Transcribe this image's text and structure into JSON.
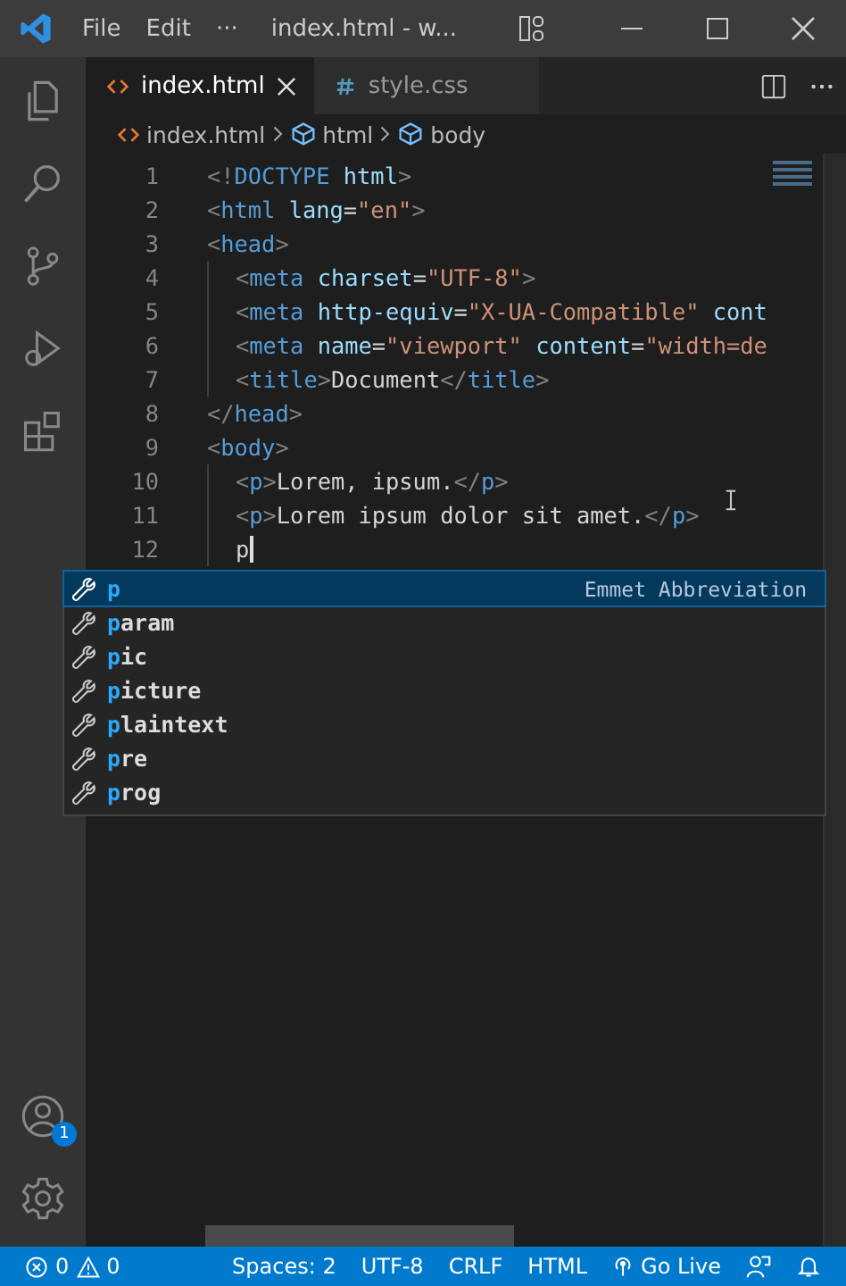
{
  "title_bar": {
    "menus": [
      "File",
      "Edit",
      "···"
    ],
    "title": "index.html - w..."
  },
  "activity_bar": {
    "account_badge": "1"
  },
  "tabs": [
    {
      "label": "index.html",
      "kind": "html",
      "selected": true
    },
    {
      "label": "style.css",
      "kind": "css",
      "selected": false
    }
  ],
  "breadcrumb": [
    {
      "label": "index.html",
      "kind": "file"
    },
    {
      "label": "html",
      "kind": "element"
    },
    {
      "label": "body",
      "kind": "element"
    }
  ],
  "editor": {
    "lines": [
      {
        "number": "1",
        "indented": false,
        "tokens": [
          {
            "kind": "bracket",
            "text": "<!"
          },
          {
            "kind": "tag",
            "text": "DOCTYPE"
          },
          {
            "kind": "attr",
            "text": " html"
          },
          {
            "kind": "bracket",
            "text": ">"
          }
        ]
      },
      {
        "number": "2",
        "indented": false,
        "tokens": [
          {
            "kind": "bracket",
            "text": "<"
          },
          {
            "kind": "tag",
            "text": "html"
          },
          {
            "kind": "attr",
            "text": " lang"
          },
          {
            "kind": "text",
            "text": "="
          },
          {
            "kind": "string",
            "text": "\"en\""
          },
          {
            "kind": "bracket",
            "text": ">"
          }
        ]
      },
      {
        "number": "3",
        "indented": false,
        "tokens": [
          {
            "kind": "bracket",
            "text": "<"
          },
          {
            "kind": "tag",
            "text": "head"
          },
          {
            "kind": "bracket",
            "text": ">"
          }
        ]
      },
      {
        "number": "4",
        "indented": true,
        "tokens": [
          {
            "kind": "bracket",
            "text": "<"
          },
          {
            "kind": "tag",
            "text": "meta"
          },
          {
            "kind": "attr",
            "text": " charset"
          },
          {
            "kind": "text",
            "text": "="
          },
          {
            "kind": "string",
            "text": "\"UTF-8\""
          },
          {
            "kind": "bracket",
            "text": ">"
          }
        ]
      },
      {
        "number": "5",
        "indented": true,
        "tokens": [
          {
            "kind": "bracket",
            "text": "<"
          },
          {
            "kind": "tag",
            "text": "meta"
          },
          {
            "kind": "attr",
            "text": " http-equiv"
          },
          {
            "kind": "text",
            "text": "="
          },
          {
            "kind": "string",
            "text": "\"X-UA-Compatible\""
          },
          {
            "kind": "attr",
            "text": " cont"
          }
        ]
      },
      {
        "number": "6",
        "indented": true,
        "tokens": [
          {
            "kind": "bracket",
            "text": "<"
          },
          {
            "kind": "tag",
            "text": "meta"
          },
          {
            "kind": "attr",
            "text": " name"
          },
          {
            "kind": "text",
            "text": "="
          },
          {
            "kind": "string",
            "text": "\"viewport\""
          },
          {
            "kind": "attr",
            "text": " content"
          },
          {
            "kind": "text",
            "text": "="
          },
          {
            "kind": "string",
            "text": "\"width=de"
          }
        ]
      },
      {
        "number": "7",
        "indented": true,
        "tokens": [
          {
            "kind": "bracket",
            "text": "<"
          },
          {
            "kind": "tag",
            "text": "title"
          },
          {
            "kind": "bracket",
            "text": ">"
          },
          {
            "kind": "text",
            "text": "Document"
          },
          {
            "kind": "bracket",
            "text": "</"
          },
          {
            "kind": "tag",
            "text": "title"
          },
          {
            "kind": "bracket",
            "text": ">"
          }
        ]
      },
      {
        "number": "8",
        "indented": false,
        "tokens": [
          {
            "kind": "bracket",
            "text": "</"
          },
          {
            "kind": "tag",
            "text": "head"
          },
          {
            "kind": "bracket",
            "text": ">"
          }
        ]
      },
      {
        "number": "9",
        "indented": false,
        "tokens": [
          {
            "kind": "bracket",
            "text": "<"
          },
          {
            "kind": "tag",
            "text": "body"
          },
          {
            "kind": "bracket",
            "text": ">"
          }
        ]
      },
      {
        "number": "10",
        "indented": true,
        "tokens": [
          {
            "kind": "bracket",
            "text": "<"
          },
          {
            "kind": "tag",
            "text": "p"
          },
          {
            "kind": "bracket",
            "text": ">"
          },
          {
            "kind": "text",
            "text": "Lorem, ipsum."
          },
          {
            "kind": "bracket",
            "text": "</"
          },
          {
            "kind": "tag",
            "text": "p"
          },
          {
            "kind": "bracket",
            "text": ">"
          }
        ]
      },
      {
        "number": "11",
        "indented": true,
        "tokens": [
          {
            "kind": "bracket",
            "text": "<"
          },
          {
            "kind": "tag",
            "text": "p"
          },
          {
            "kind": "bracket",
            "text": ">"
          },
          {
            "kind": "text",
            "text": "Lorem ipsum dolor sit amet."
          },
          {
            "kind": "bracket",
            "text": "</"
          },
          {
            "kind": "tag",
            "text": "p"
          },
          {
            "kind": "bracket",
            "text": ">"
          }
        ]
      },
      {
        "number": "12",
        "indented": true,
        "tokens": [
          {
            "kind": "text",
            "text": "p"
          }
        ]
      }
    ]
  },
  "suggestions": [
    {
      "label": "**p**",
      "detail": "Emmet Abbreviation",
      "selected": true
    },
    {
      "label": "**p**aram",
      "selected": false
    },
    {
      "label": "**p**ic",
      "selected": false
    },
    {
      "label": "**p**icture",
      "selected": false
    },
    {
      "label": "**p**laintext",
      "selected": false
    },
    {
      "label": "**p**re",
      "selected": false
    },
    {
      "label": "**p**rog",
      "selected": false
    }
  ],
  "status_bar": {
    "errors": "0",
    "warnings": "0",
    "items": [
      "Spaces: 2",
      "UTF-8",
      "CRLF",
      "HTML"
    ],
    "go_live": "Go Live"
  }
}
